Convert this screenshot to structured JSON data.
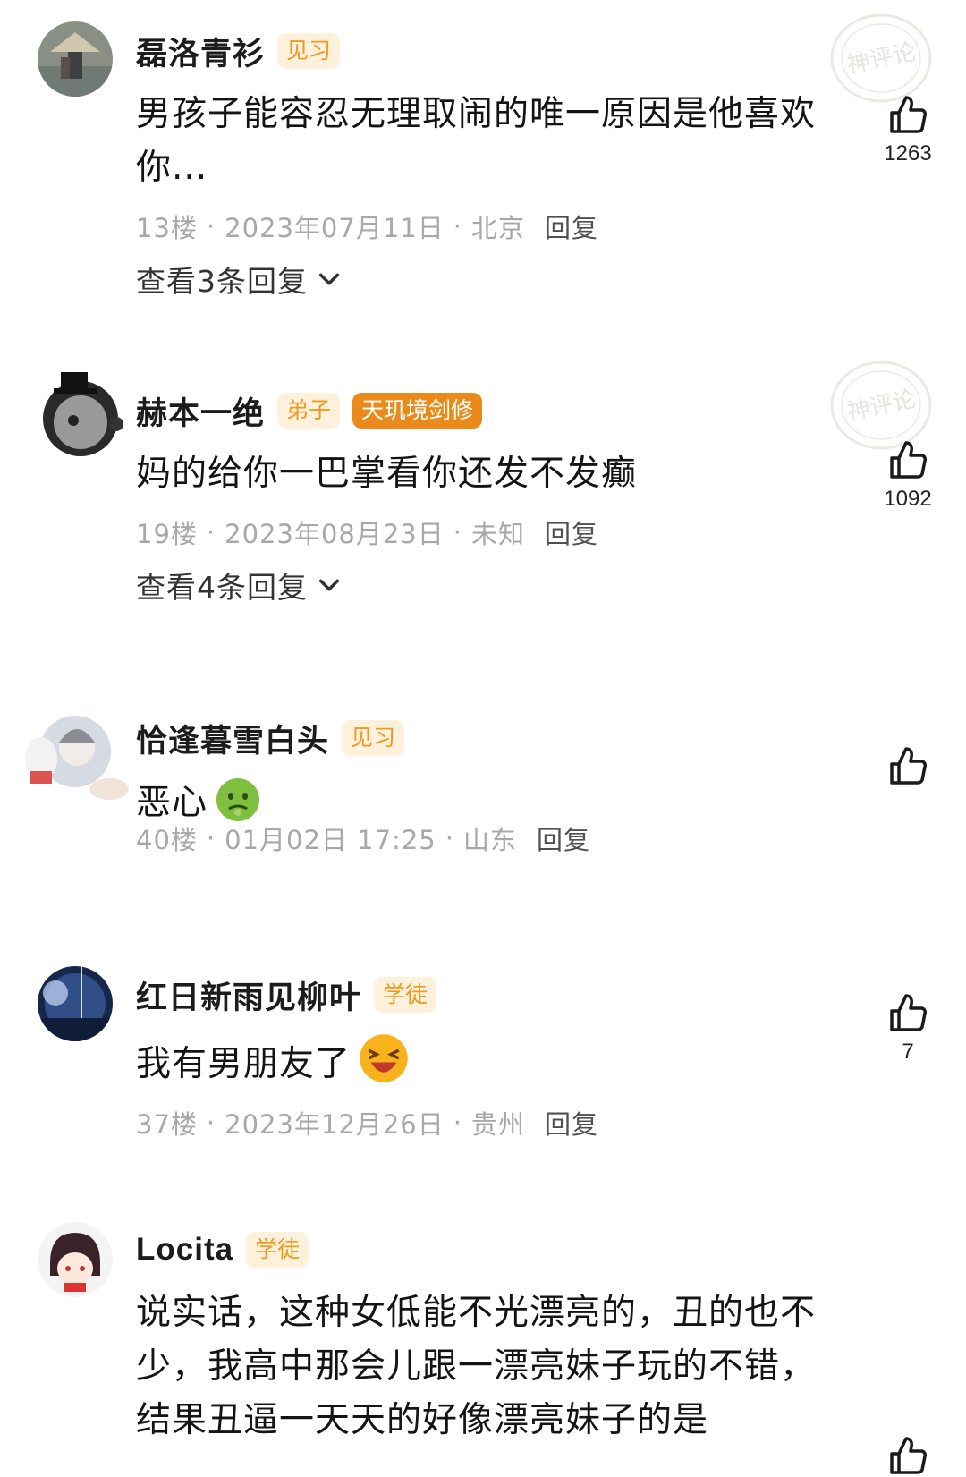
{
  "comments": [
    {
      "name": "磊洛青衫",
      "badges": [
        "见习"
      ],
      "text": "男孩子能容忍无理取闹的唯一原因是他喜欢你...",
      "floor": "13楼",
      "date": "2023年07月11日",
      "location": "北京",
      "reply_label": "回复",
      "view_replies": "查看3条回复",
      "likes": "1263",
      "stamp": "神评论"
    },
    {
      "name": "赫本一绝",
      "badges": [
        "弟子",
        "天玑境剑修"
      ],
      "text": "妈的给你一巴掌看你还发不发癫",
      "floor": "19楼",
      "date": "2023年08月23日",
      "location": "未知",
      "reply_label": "回复",
      "view_replies": "查看4条回复",
      "likes": "1092",
      "stamp": "神评论"
    },
    {
      "name": "恰逢暮雪白头",
      "badges": [
        "见习"
      ],
      "text": "恶心",
      "emoji": "nauseated-face",
      "floor": "40楼",
      "date": "01月02日 17:25",
      "location": "山东",
      "reply_label": "回复",
      "likes": ""
    },
    {
      "name": "红日新雨见柳叶",
      "badges": [
        "学徒"
      ],
      "text": "我有男朋友了",
      "emoji": "laughing-face",
      "floor": "37楼",
      "date": "2023年12月26日",
      "location": "贵州",
      "reply_label": "回复",
      "likes": "7"
    },
    {
      "name": "Locita",
      "badges": [
        "学徒"
      ],
      "text": "说实话，这种女低能不光漂亮的，丑的也不少，我高中那会儿跟一漂亮妹子玩的不错，结果丑逼一天天的好像漂亮妹子的是"
    }
  ],
  "colors": {
    "badge_bg": "#fdf1dc",
    "badge_text": "#ec9a24",
    "badge_solid": "#ea8a1b",
    "meta": "#a8a8a8"
  }
}
